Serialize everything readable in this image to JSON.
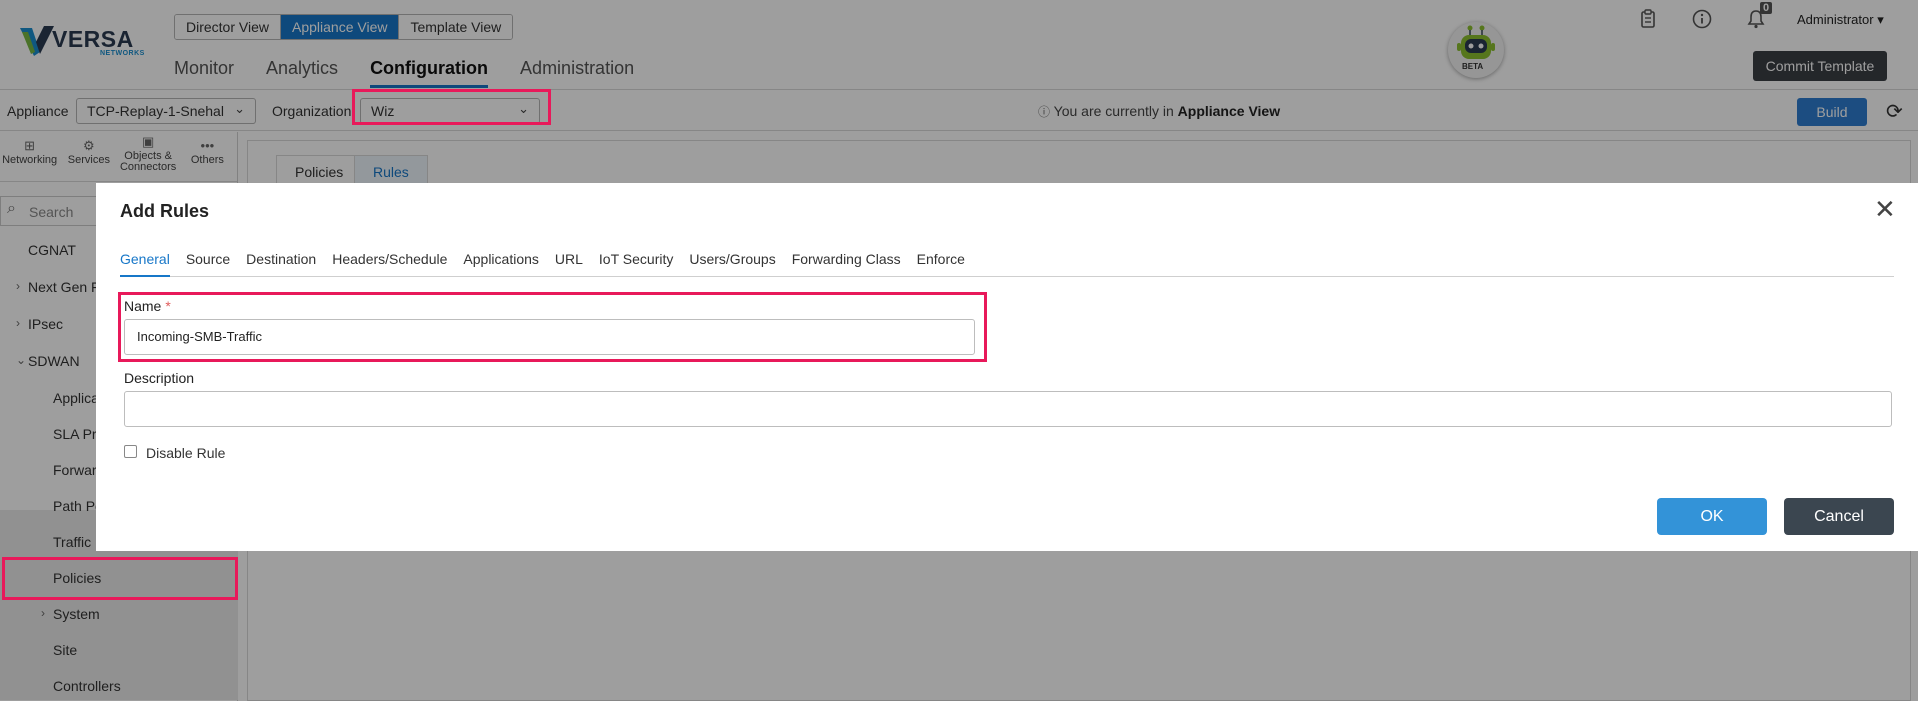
{
  "brand": {
    "name": "VERSA",
    "sub": "NETWORKS"
  },
  "view_switch": [
    {
      "label": "Director View",
      "active": false
    },
    {
      "label": "Appliance View",
      "active": true
    },
    {
      "label": "Template View",
      "active": false
    }
  ],
  "main_nav": [
    {
      "label": "Monitor",
      "active": false
    },
    {
      "label": "Analytics",
      "active": false
    },
    {
      "label": "Configuration",
      "active": true
    },
    {
      "label": "Administration",
      "active": false
    }
  ],
  "assistant": {
    "badge": "BETA"
  },
  "header": {
    "notifications_count": "0",
    "user": "Administrator ▾",
    "commit_label": "Commit Template"
  },
  "subbar": {
    "appliance_label": "Appliance",
    "appliance_value": "TCP-Replay-1-Snehal",
    "organization_label": "Organization",
    "organization_value": "Wiz",
    "info_prefix": "You are currently in ",
    "info_bold": "Appliance View",
    "build_label": "Build"
  },
  "sidebar": {
    "tabs": [
      {
        "label": "Networking",
        "icon": "network-icon"
      },
      {
        "label": "Services",
        "icon": "services-icon"
      },
      {
        "label": "Objects & Connectors",
        "icon": "objects-icon"
      },
      {
        "label": "Others",
        "icon": "more-icon"
      }
    ],
    "search_placeholder": "Search",
    "items": [
      {
        "label": "CGNAT"
      },
      {
        "label": "Next Gen F"
      },
      {
        "label": "IPsec"
      },
      {
        "label": "SDWAN"
      },
      {
        "label": "Applica"
      },
      {
        "label": "SLA Pr"
      },
      {
        "label": "Forwar"
      },
      {
        "label": "Path Po"
      },
      {
        "label": "Traffic"
      },
      {
        "label": "Policies"
      },
      {
        "label": "System"
      },
      {
        "label": "Site"
      },
      {
        "label": "Controllers"
      }
    ]
  },
  "content_tabs": [
    "Policies",
    "Rules"
  ],
  "modal": {
    "title": "Add Rules",
    "tabs": [
      "General",
      "Source",
      "Destination",
      "Headers/Schedule",
      "Applications",
      "URL",
      "IoT Security",
      "Users/Groups",
      "Forwarding Class",
      "Enforce"
    ],
    "name_label": "Name",
    "name_required": "*",
    "name_value": "Incoming-SMB-Traffic",
    "description_label": "Description",
    "description_value": "",
    "disable_rule_label": "Disable Rule",
    "disable_rule_checked": false,
    "ok_label": "OK",
    "cancel_label": "Cancel"
  },
  "colors": {
    "accent": "#1777c8",
    "highlight": "#e8195a",
    "ok_button": "#3393d8",
    "cancel_button": "#3b4650",
    "commit_button": "#3b3f45"
  }
}
